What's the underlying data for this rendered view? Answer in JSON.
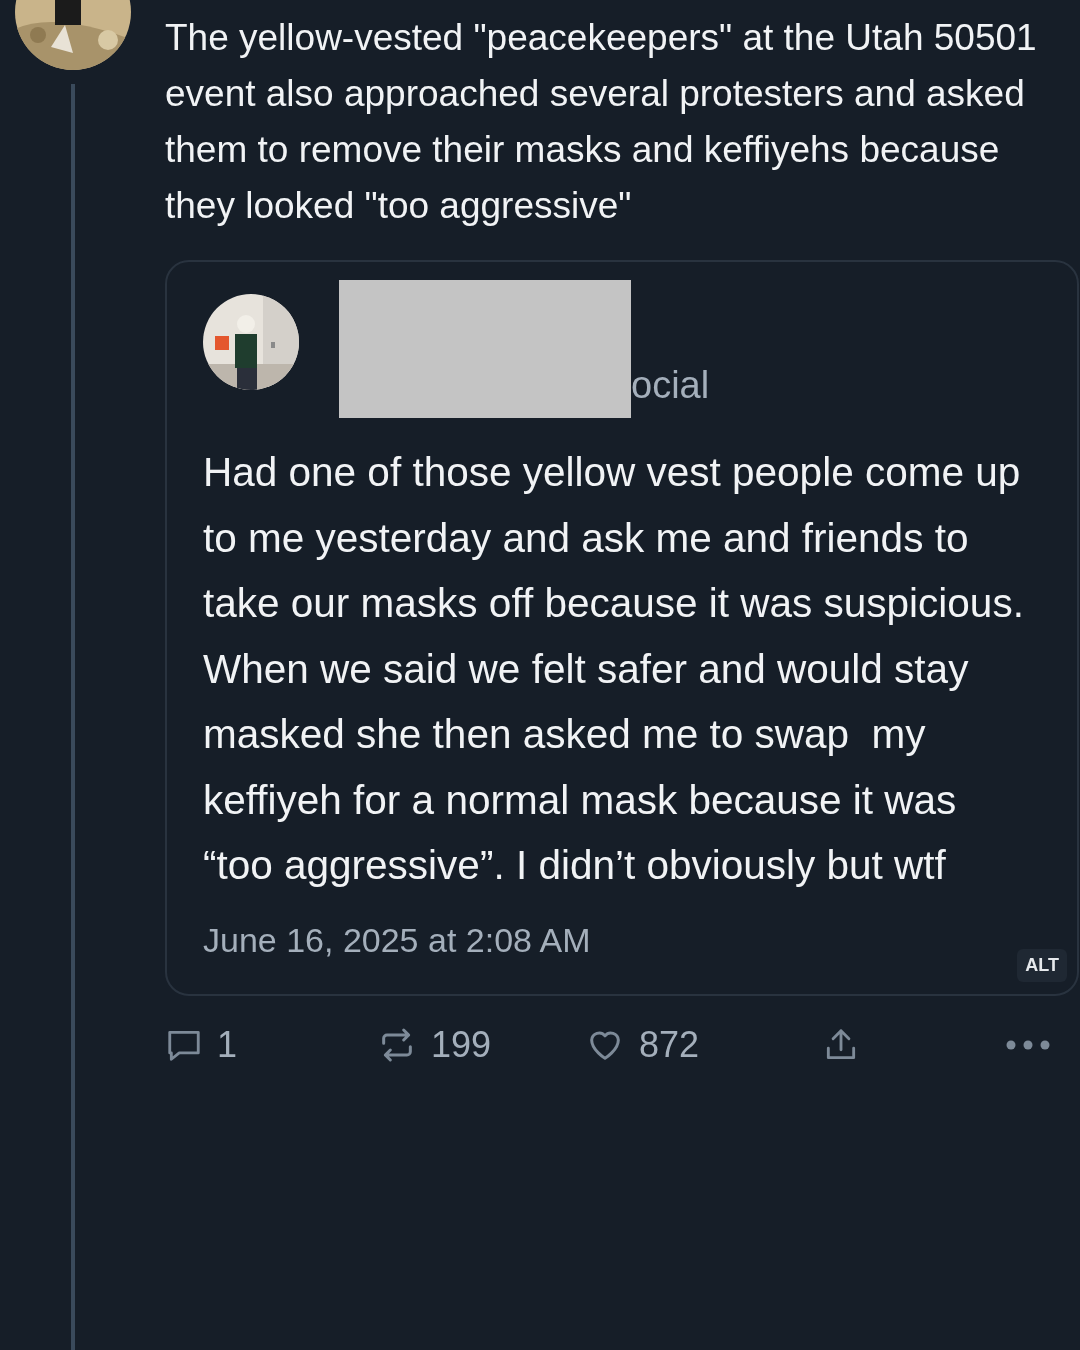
{
  "post": {
    "text": "The yellow-vested \"peacekeepers\" at the Utah 50501 event also approached several protesters and asked them to remove their masks and keffiyehs because they looked \"too aggressive\"",
    "quote": {
      "handle": "ocial",
      "text": "Had one of those yellow vest people come up to me yesterday and ask me and friends to take our masks off because it was suspicious. When we said we felt safer and would stay masked she then asked me to swap  my keffiyeh for a normal mask because it was “too aggressive”. I didn’t obviously but wtf",
      "timestamp": "June 16, 2025 at 2:08 AM",
      "badge": "ALT"
    },
    "actions": [
      {
        "kind": "reply",
        "count": "1"
      },
      {
        "kind": "repost",
        "count": "199"
      },
      {
        "kind": "like",
        "count": "872"
      },
      {
        "kind": "share"
      },
      {
        "kind": "more"
      }
    ]
  }
}
